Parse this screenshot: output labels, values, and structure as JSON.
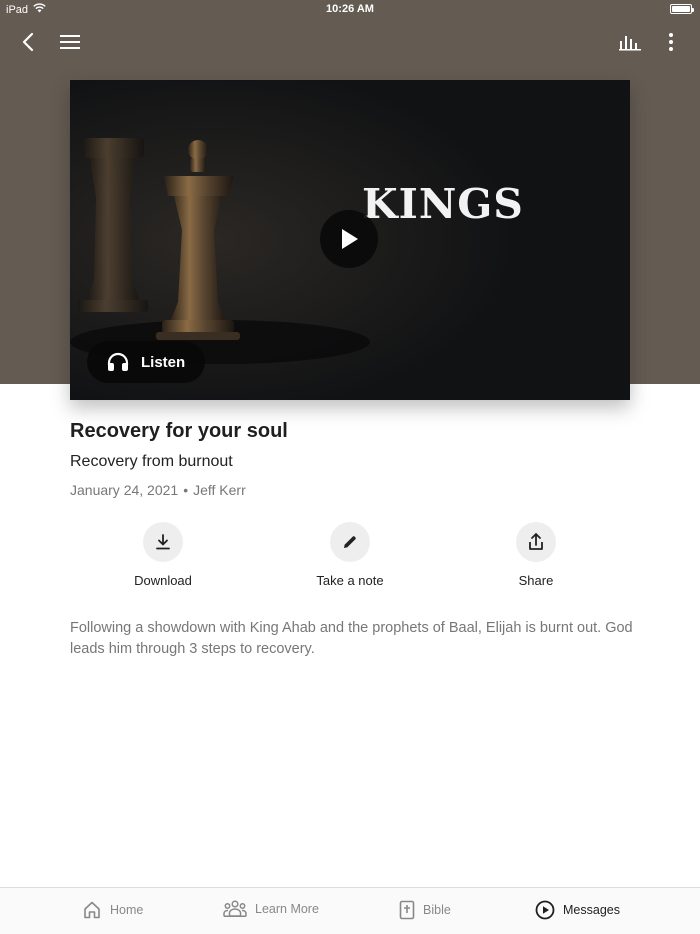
{
  "status_bar": {
    "device": "iPad",
    "time": "10:26 AM"
  },
  "header": {
    "icons": {
      "back": "chevron-left-icon",
      "menu": "hamburger-menu-icon",
      "stats": "audio-bars-icon",
      "more": "more-vertical-icon"
    }
  },
  "media": {
    "artwork_title": "KINGS",
    "play_icon": "play-icon",
    "listen_label": "Listen",
    "listen_icon": "headphones-icon"
  },
  "message": {
    "title": "Recovery for your soul",
    "subtitle": "Recovery from burnout",
    "date": "January 24, 2021",
    "separator": "•",
    "speaker": "Jeff Kerr",
    "description": "Following a showdown with King Ahab and the prophets of Baal, Elijah is burnt out. God leads him through 3 steps to recovery."
  },
  "actions": [
    {
      "label": "Download",
      "icon": "download-icon"
    },
    {
      "label": "Take a note",
      "icon": "pencil-icon"
    },
    {
      "label": "Share",
      "icon": "share-icon"
    }
  ],
  "tab_bar": [
    {
      "label": "Home",
      "icon": "home-icon",
      "active": false
    },
    {
      "label": "Learn More",
      "icon": "people-icon",
      "active": false
    },
    {
      "label": "Bible",
      "icon": "bible-icon",
      "active": false
    },
    {
      "label": "Messages",
      "icon": "play-circle-icon",
      "active": true
    }
  ],
  "colors": {
    "hero_background": "#645c53",
    "text_primary": "#1f1f1f",
    "text_secondary": "#777777",
    "tab_inactive": "#888888"
  }
}
